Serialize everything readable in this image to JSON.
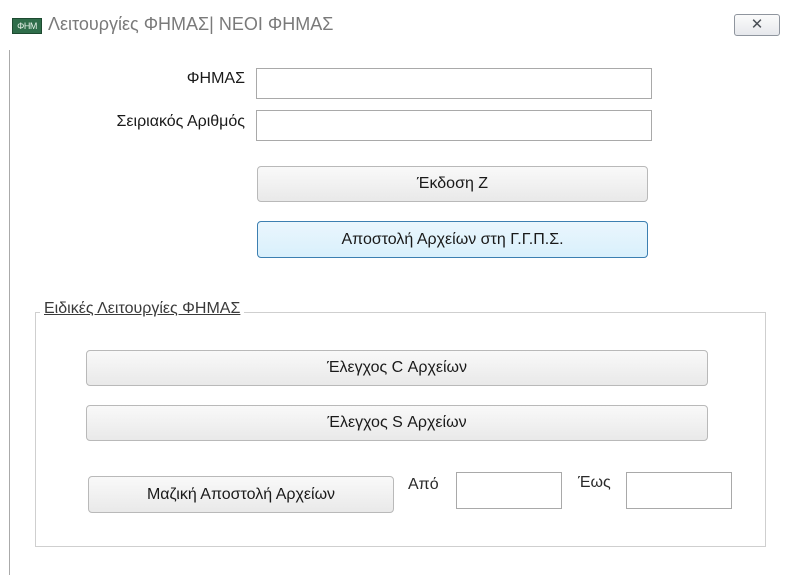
{
  "window": {
    "icon_text": "ΦΗΜ",
    "title": "Λειτουργίες ΦΗΜΑΣ| ΝΕΟΙ ΦΗΜΑΣ",
    "close_symbol": "✕"
  },
  "form": {
    "fhmas_label": "ΦΗΜΑΣ",
    "fhmas_value": "",
    "serial_label": "Σειριακός Αριθμός",
    "serial_value": "",
    "issue_z_button": "Έκδοση Ζ",
    "send_files_button": "Αποστολή Αρχείων στη Γ.Γ.Π.Σ."
  },
  "special": {
    "group_title": "Ειδικές Λειτουργίες ΦΗΜΑΣ",
    "check_c_button": "Έλεγχος C Αρχείων",
    "check_s_button": "Έλεγχος S Αρχείων",
    "bulk_send_button": "Μαζική Αποστολή Αρχείων",
    "from_label": "Από",
    "from_value": "",
    "to_label": "Έως",
    "to_value": ""
  }
}
